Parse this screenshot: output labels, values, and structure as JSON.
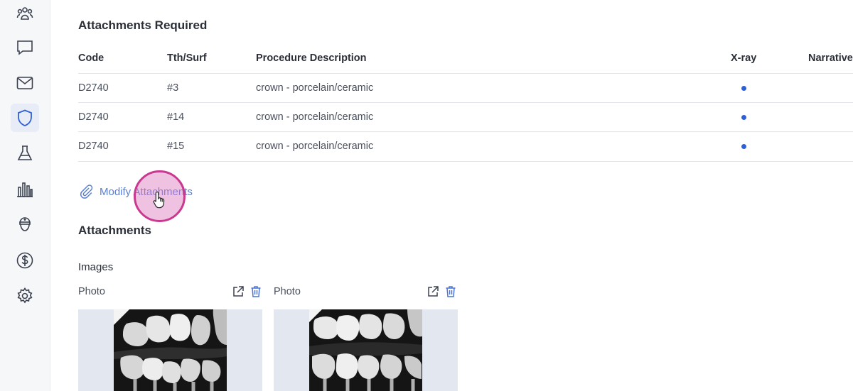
{
  "sidebar": {
    "items": [
      {
        "icon": "people-group-icon",
        "active": false
      },
      {
        "icon": "chat-bubble-icon",
        "active": false
      },
      {
        "icon": "envelope-icon",
        "active": false
      },
      {
        "icon": "shield-icon",
        "active": true
      },
      {
        "icon": "flask-icon",
        "active": false
      },
      {
        "icon": "bar-chart-icon",
        "active": false
      },
      {
        "icon": "doctor-icon",
        "active": false
      },
      {
        "icon": "dollar-icon",
        "active": false
      },
      {
        "icon": "gear-icon",
        "active": false
      }
    ]
  },
  "attachments_required": {
    "title": "Attachments Required",
    "columns": {
      "code": "Code",
      "tooth_surface": "Tth/Surf",
      "description": "Procedure Description",
      "xray": "X-ray",
      "narrative": "Narrative"
    },
    "rows": [
      {
        "code": "D2740",
        "tooth": "#3",
        "description": "crown - porcelain/ceramic",
        "xray_required": true
      },
      {
        "code": "D2740",
        "tooth": "#14",
        "description": "crown - porcelain/ceramic",
        "xray_required": true
      },
      {
        "code": "D2740",
        "tooth": "#15",
        "description": "crown - porcelain/ceramic",
        "xray_required": true
      }
    ]
  },
  "modify_link": {
    "label": "Modify Attachments",
    "icon": "paperclip-icon"
  },
  "attachments": {
    "title": "Attachments",
    "images_label": "Images",
    "photos": [
      {
        "label": "Photo",
        "actions": [
          "open-external-icon",
          "trash-icon"
        ]
      },
      {
        "label": "Photo",
        "actions": [
          "open-external-icon",
          "trash-icon"
        ]
      }
    ]
  },
  "colors": {
    "accent": "#2f5fd6",
    "link": "#5a7fd4",
    "sidebar_bg": "#f6f7f9",
    "cursor_highlight": "#c9398f"
  }
}
